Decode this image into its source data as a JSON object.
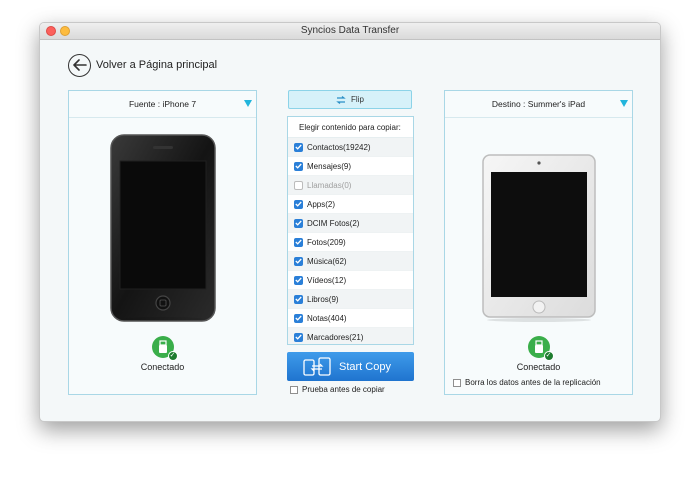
{
  "window": {
    "title": "Syncios Data Transfer"
  },
  "nav": {
    "back_label": "Volver a Página principal"
  },
  "source": {
    "label": "Fuente : iPhone 7",
    "status": "Conectado"
  },
  "destination": {
    "label": "Destino : Summer's iPad",
    "status": "Conectado",
    "clear_label": "Borra los datos antes de la replicación"
  },
  "flip": {
    "label": "Flip"
  },
  "content": {
    "header": "Elegir contenido para copiar:",
    "items": [
      {
        "label": "Contactos(19242)",
        "checked": true
      },
      {
        "label": "Mensajes(9)",
        "checked": true
      },
      {
        "label": "Llamadas(0)",
        "checked": false
      },
      {
        "label": "Apps(2)",
        "checked": true
      },
      {
        "label": "DCIM Fotos(2)",
        "checked": true
      },
      {
        "label": "Fotos(209)",
        "checked": true
      },
      {
        "label": "Música(62)",
        "checked": true
      },
      {
        "label": "Vídeos(12)",
        "checked": true
      },
      {
        "label": "Libros(9)",
        "checked": true
      },
      {
        "label": "Notas(404)",
        "checked": true
      },
      {
        "label": "Marcadores(21)",
        "checked": true
      }
    ]
  },
  "actions": {
    "start_label": "Start Copy",
    "test_label": "Prueba antes de copiar"
  },
  "colors": {
    "accent": "#1f74cf",
    "panel_border": "#a9d7e6",
    "connected": "#3aae4a"
  }
}
